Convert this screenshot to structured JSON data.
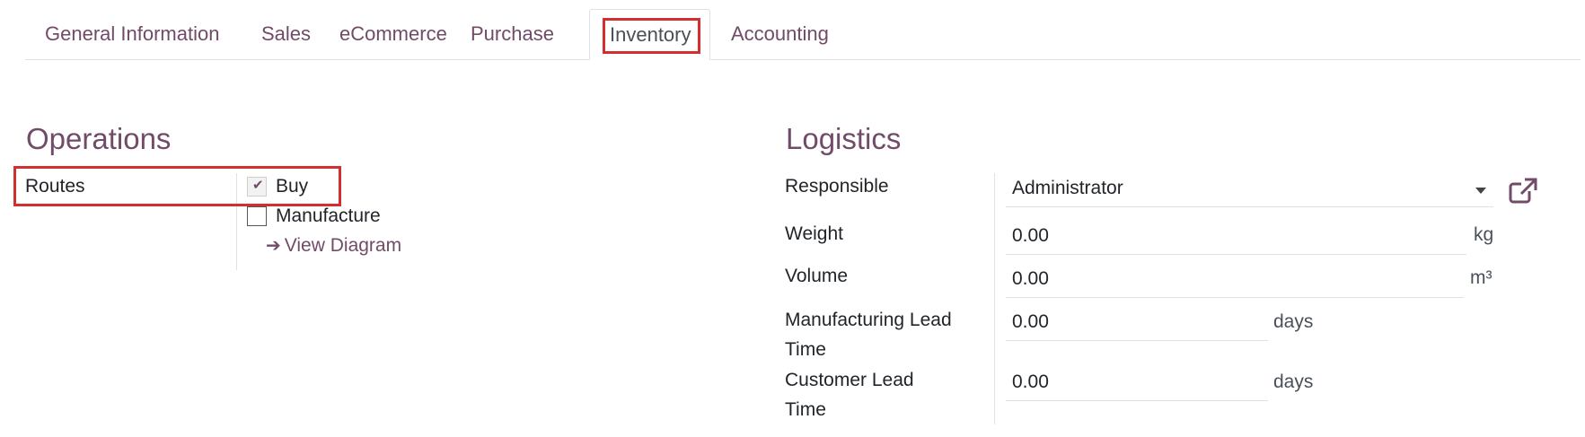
{
  "tabs": [
    {
      "label": "General Information"
    },
    {
      "label": "Sales"
    },
    {
      "label": "eCommerce"
    },
    {
      "label": "Purchase"
    },
    {
      "label": "Inventory"
    },
    {
      "label": "Accounting"
    }
  ],
  "active_tab": "Inventory",
  "operations": {
    "title": "Operations",
    "routes_label": "Routes",
    "routes": [
      {
        "label": "Buy",
        "checked": true
      },
      {
        "label": "Manufacture",
        "checked": false
      }
    ],
    "view_diagram": "View Diagram"
  },
  "logistics": {
    "title": "Logistics",
    "responsible": {
      "label": "Responsible",
      "value": "Administrator"
    },
    "weight": {
      "label": "Weight",
      "value": "0.00",
      "unit": "kg"
    },
    "volume": {
      "label": "Volume",
      "value": "0.00",
      "unit": "m³"
    },
    "manufacturing_lead_time": {
      "label_line1": "Manufacturing Lead",
      "label_line2": "Time",
      "value": "0.00",
      "unit": "days"
    },
    "customer_lead_time": {
      "label_line1": "Customer Lead",
      "label_line2": "Time",
      "value": "0.00",
      "unit": "days"
    }
  },
  "colors": {
    "accent": "#714b67",
    "highlight": "#d32f2f"
  }
}
